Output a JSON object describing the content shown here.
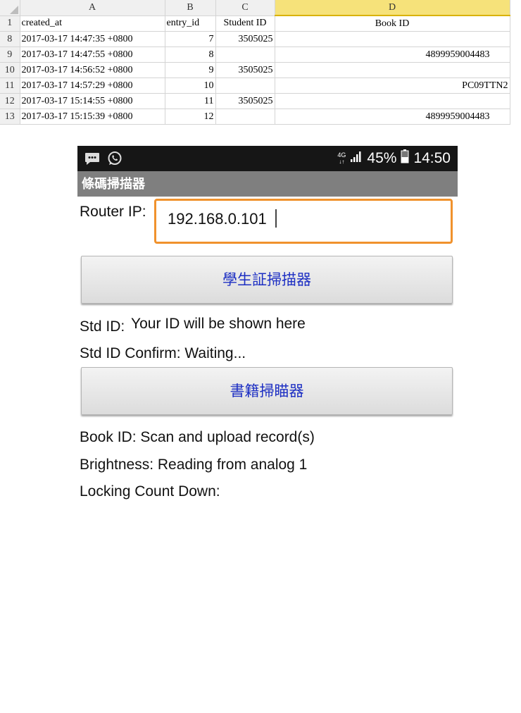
{
  "sheet": {
    "columns": [
      "A",
      "B",
      "C",
      "D"
    ],
    "header_row": {
      "num": "1",
      "a": "created_at",
      "b": "entry_id",
      "c": "Student ID",
      "d": "Book ID"
    },
    "rows": [
      {
        "num": "8",
        "created_at": "2017-03-17 14:47:35 +0800",
        "entry_id": "7",
        "student_id": "3505025",
        "book_id": ""
      },
      {
        "num": "9",
        "created_at": "2017-03-17 14:47:55 +0800",
        "entry_id": "8",
        "student_id": "",
        "book_id": "4899959004483"
      },
      {
        "num": "10",
        "created_at": "2017-03-17 14:56:52 +0800",
        "entry_id": "9",
        "student_id": "3505025",
        "book_id": ""
      },
      {
        "num": "11",
        "created_at": "2017-03-17 14:57:29 +0800",
        "entry_id": "10",
        "student_id": "",
        "book_id": "PC09TTN2"
      },
      {
        "num": "12",
        "created_at": "2017-03-17 15:14:55 +0800",
        "entry_id": "11",
        "student_id": "3505025",
        "book_id": ""
      },
      {
        "num": "13",
        "created_at": "2017-03-17 15:15:39 +0800",
        "entry_id": "12",
        "student_id": "",
        "book_id": "4899959004483"
      }
    ]
  },
  "statusbar": {
    "left_icons": [
      "message-icon",
      "whatsapp-icon"
    ],
    "network": "4G",
    "battery": "45%",
    "time": "14:50"
  },
  "app": {
    "title": "條碼掃描器",
    "router_label": "Router IP:",
    "router_value": "192.168.0.101",
    "student_scan_button": "學生証掃描器",
    "std_id_label": "Std ID:",
    "std_id_value": "Your ID will be shown here",
    "std_confirm": "Std ID Confirm: Waiting...",
    "book_scan_button": "書籍掃瞄器",
    "book_id": "Book ID: Scan and upload record(s)",
    "brightness": "Brightness: Reading from analog 1",
    "countdown": "Locking Count Down:"
  },
  "colors": {
    "accent_orange": "#f0922d",
    "button_text": "#1d2fc3",
    "titlebar": "#7f7f7f",
    "statusbar": "#161616",
    "selected_column": "#f6e27a"
  }
}
